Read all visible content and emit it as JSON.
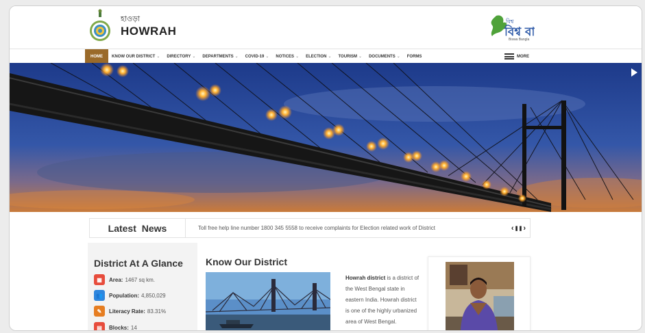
{
  "header": {
    "site_name_local": "হাওড়া",
    "site_name": "HOWRAH",
    "emblem_icon": "west-bengal-emblem",
    "partner_logo": "biswa-bangla-logo",
    "partner_logo_tagline": "Biswa Bangla",
    "partner_logo_text": "বিশ্ব বাংলা"
  },
  "nav": {
    "items": [
      {
        "label": "HOME",
        "dropdown": false,
        "active": true
      },
      {
        "label": "KNOW OUR DISTRICT",
        "dropdown": true,
        "active": false
      },
      {
        "label": "DIRECTORY",
        "dropdown": true,
        "active": false
      },
      {
        "label": "DEPARTMENTS",
        "dropdown": true,
        "active": false
      },
      {
        "label": "COVID-19",
        "dropdown": true,
        "active": false
      },
      {
        "label": "NOTICES",
        "dropdown": true,
        "active": false
      },
      {
        "label": "ELECTION",
        "dropdown": true,
        "active": false
      },
      {
        "label": "TOURISM",
        "dropdown": true,
        "active": false
      },
      {
        "label": "DOCUMENTS",
        "dropdown": true,
        "active": false
      },
      {
        "label": "FORMS",
        "dropdown": false,
        "active": false
      }
    ],
    "more_label": "MORE",
    "active_color": "#9a6a2a"
  },
  "news": {
    "title": "Latest News",
    "ticker": "Toll free help line number 1800 345 5558 to receive complaints for Election related work of District",
    "prev_label": "‹",
    "pause_label": "❚❚",
    "next_label": "›"
  },
  "glance": {
    "title": "District At A Glance",
    "stats": [
      {
        "label": "Area:",
        "value": "1467 sq km.",
        "icon": "map-icon",
        "color": "#e74c3c"
      },
      {
        "label": "Population:",
        "value": "4,850,029",
        "icon": "people-icon",
        "color": "#2e86de"
      },
      {
        "label": "Literacy Rate:",
        "value": "83.31%",
        "icon": "book-icon",
        "color": "#e67e22"
      },
      {
        "label": "Blocks:",
        "value": "14",
        "icon": "blocks-icon",
        "color": "#e74c3c"
      }
    ]
  },
  "know": {
    "title": "Know Our District",
    "text_bold": "Howrah district",
    "text": " is a district of the West Bengal state in eastern India. Howrah district is one of the highly urbanized area of West Bengal."
  }
}
